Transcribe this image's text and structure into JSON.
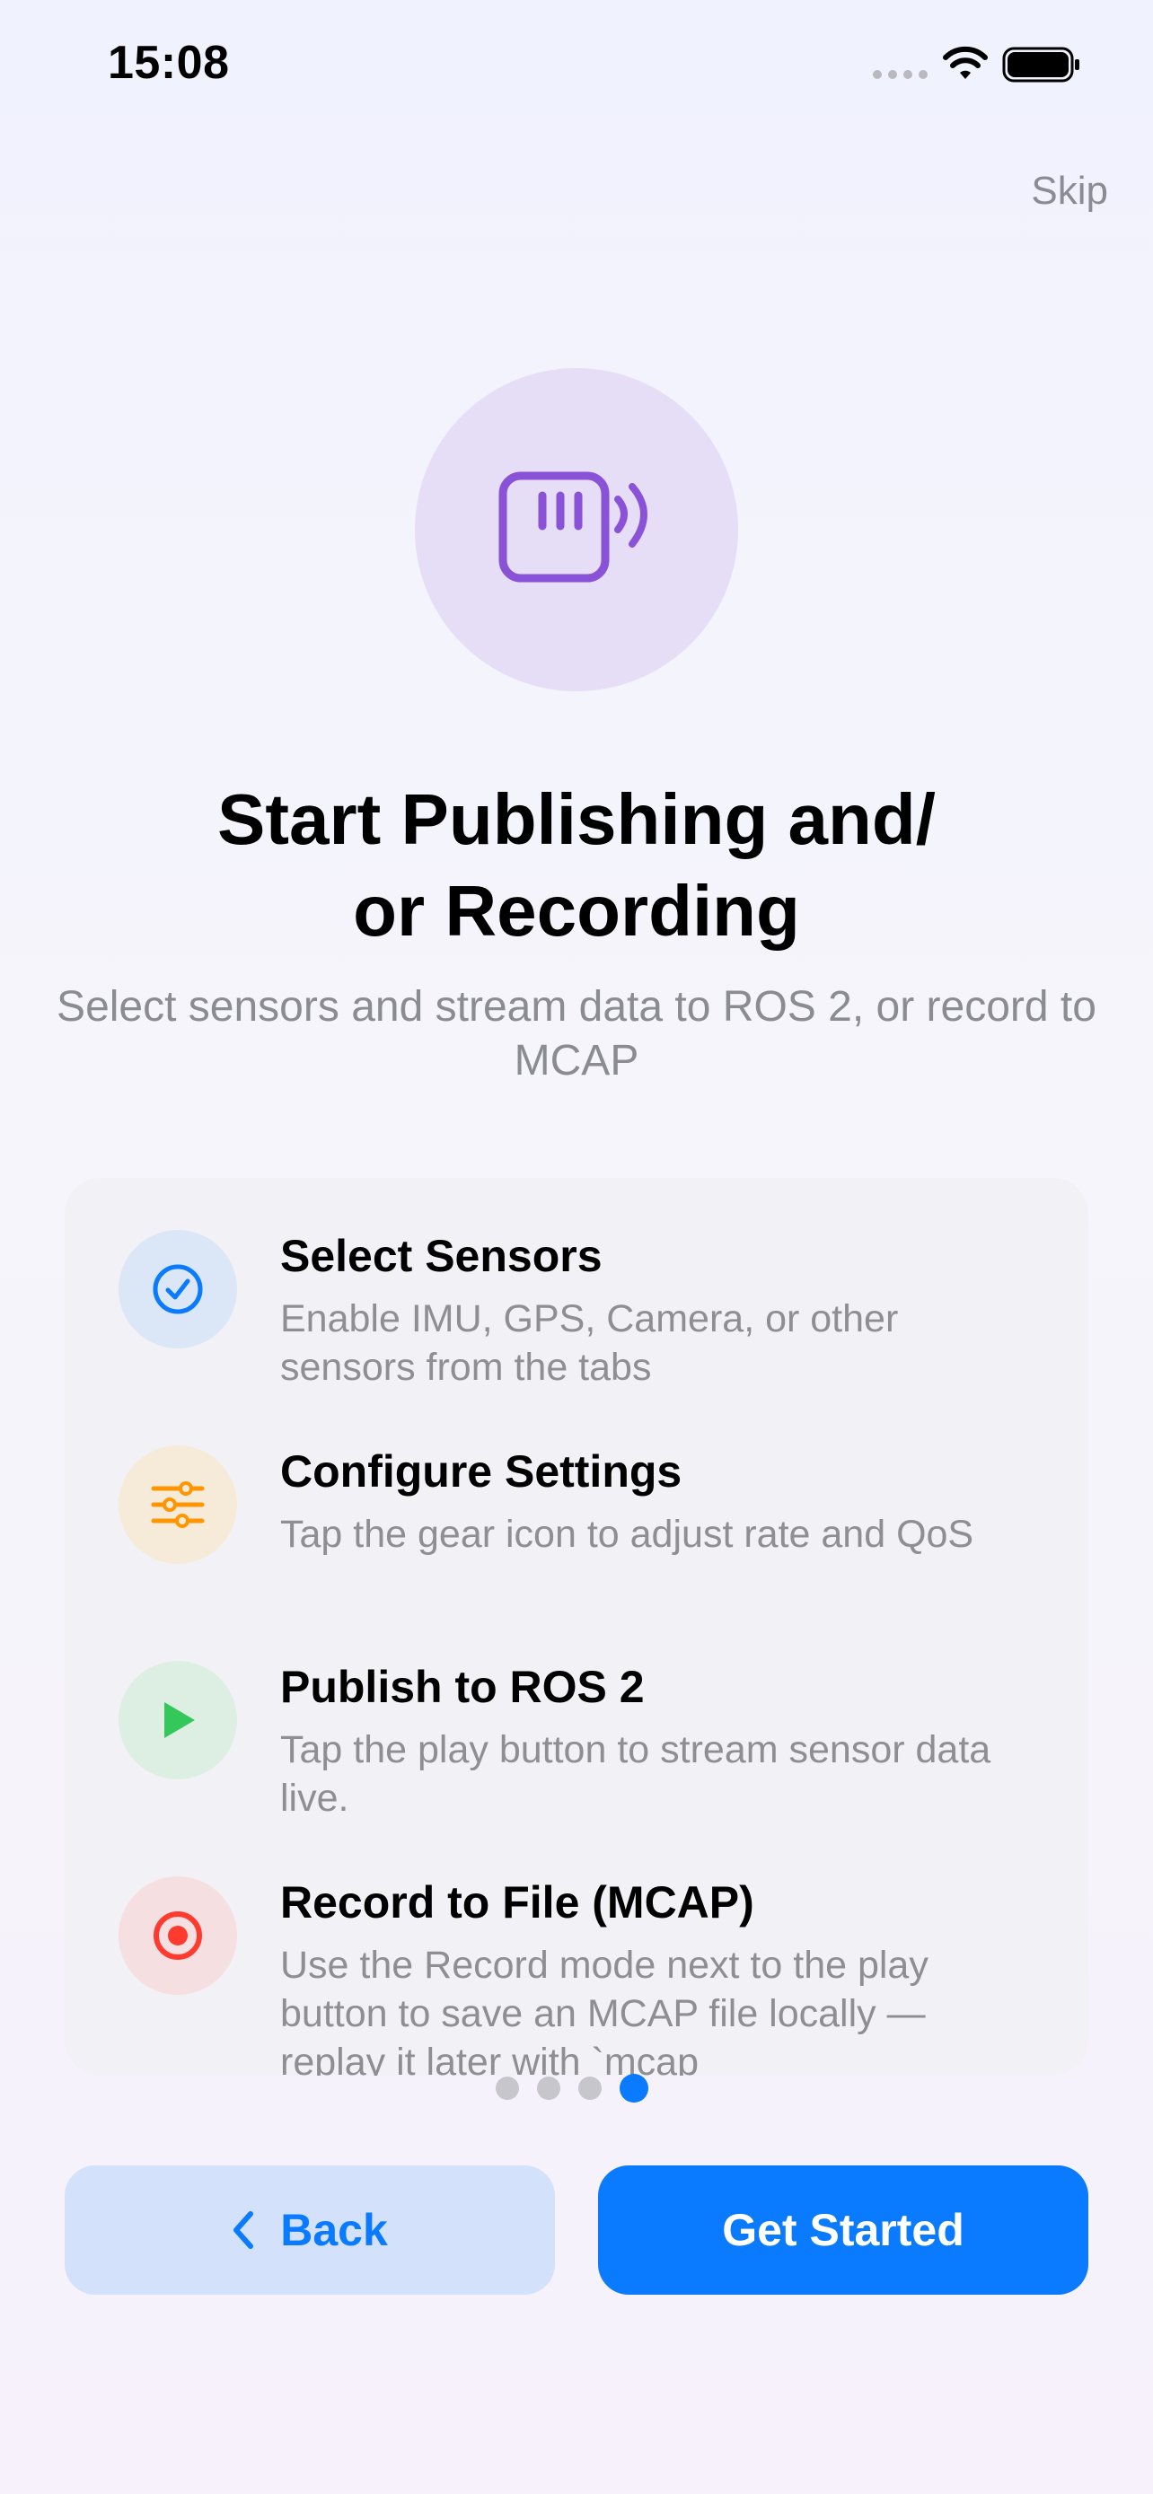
{
  "status_bar": {
    "time": "15:08"
  },
  "header": {
    "skip_label": "Skip"
  },
  "hero": {
    "icon": "sensor-broadcast-icon",
    "accent": "#8a52d6",
    "circle": "#e6ddf6"
  },
  "title_lines": [
    "Start Publishing and/",
    "or Recording"
  ],
  "subtitle": "Select sensors and stream data to ROS 2, or record to MCAP",
  "steps": [
    {
      "title": "Select Sensors",
      "description": "Enable IMU, GPS, Camera, or other sensors from the tabs",
      "icon": "checkmark-circle-icon",
      "color": "#0a7aff"
    },
    {
      "title": "Configure Settings",
      "description": "Tap the gear icon to adjust rate and QoS",
      "icon": "sliders-icon",
      "color": "#ff9500"
    },
    {
      "title": "Publish to ROS 2",
      "description": "Tap the play button to stream sensor data live.",
      "icon": "play-icon",
      "color": "#34c759"
    },
    {
      "title": "Record to File (MCAP)",
      "description": "Use the Record mode next to the play button to save an MCAP file locally — replay it later with `mcap",
      "icon": "record-icon",
      "color": "#ff3b30"
    }
  ],
  "pagination": {
    "total": 4,
    "current": 4
  },
  "buttons": {
    "back_label": "Back",
    "start_label": "Get Started",
    "primary_color": "#0a7aff"
  }
}
